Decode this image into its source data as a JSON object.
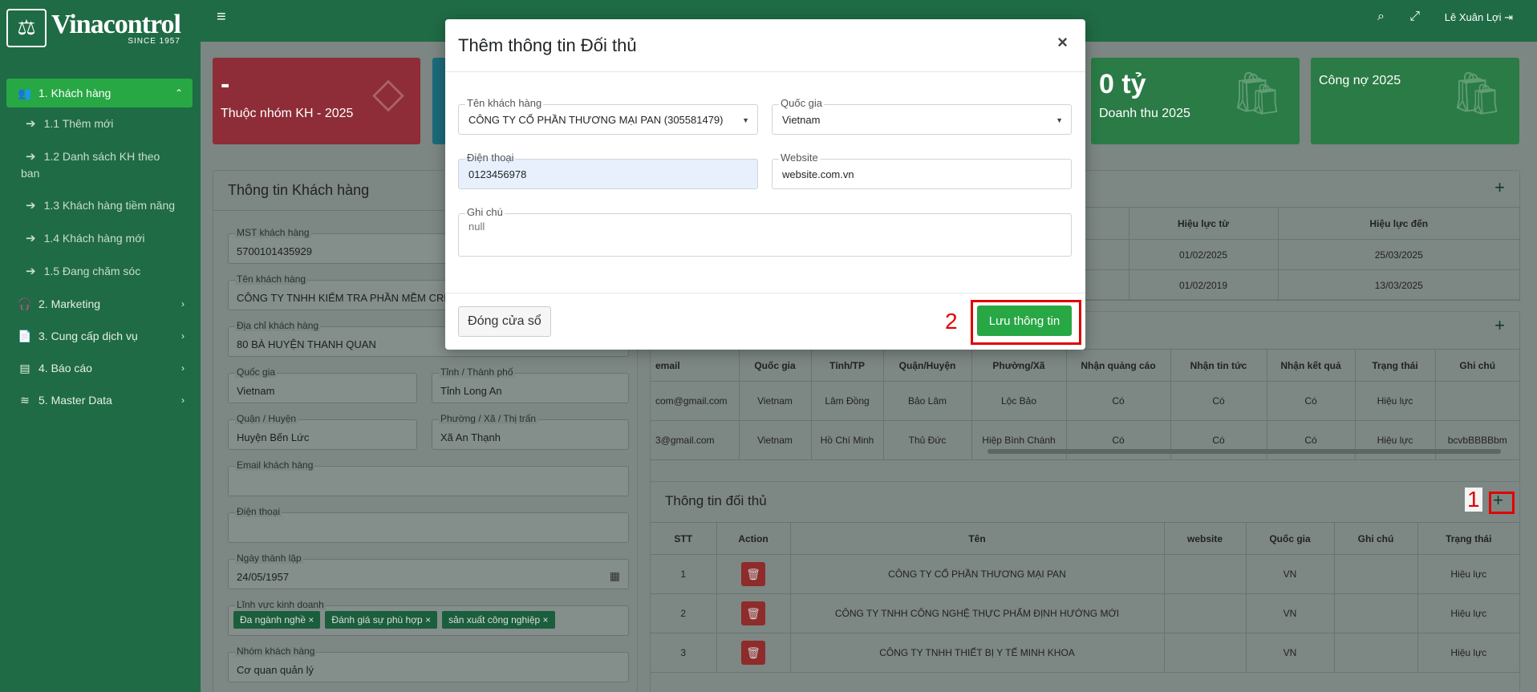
{
  "brand": {
    "name": "Vinacontrol",
    "since": "SINCE 1957",
    "mark": "⚖"
  },
  "sidebar": {
    "items": [
      {
        "label": "1. Khách hàng",
        "icon": "users-icon",
        "glyph": "👥",
        "expanded": true
      },
      {
        "label": "2. Marketing",
        "icon": "headset-icon",
        "glyph": "🎧"
      },
      {
        "label": "3. Cung cấp dịch vụ",
        "icon": "file-icon",
        "glyph": "📄"
      },
      {
        "label": "4. Báo cáo",
        "icon": "report-icon",
        "glyph": "▤"
      },
      {
        "label": "5. Master Data",
        "icon": "database-icon",
        "glyph": "≋"
      }
    ],
    "sub_items": [
      "1.1 Thêm mới",
      "1.2 Danh sách KH theo ban",
      "1.3 Khách hàng tiềm năng",
      "1.4 Khách hàng mới",
      "1.5 Đang chăm sóc"
    ]
  },
  "topbar": {
    "user": "Lê Xuân Lợi"
  },
  "tiles": [
    {
      "big": "-",
      "sub": "Thuộc nhóm KH - 2025",
      "color": "#8e2d37"
    },
    {
      "big": "0 tỷ",
      "sub": "Doanh thu 2025",
      "color": "#2a7b45"
    },
    {
      "big": "",
      "sub": "Công nợ 2025",
      "color": "#2a7b45"
    }
  ],
  "customer_panel": {
    "title": "Thông tin Khách hàng",
    "fields": {
      "mst": {
        "label": "MST khách hàng",
        "value": "5700101435929"
      },
      "name": {
        "label": "Tên khách hàng",
        "value": "CÔNG TY TNHH KIỂM TRA PHẦN MỀM CRM"
      },
      "address": {
        "label": "Địa chỉ khách hàng",
        "value": "80 BÀ HUYỆN THANH QUAN"
      },
      "country": {
        "label": "Quốc gia",
        "value": "Vietnam"
      },
      "province": {
        "label": "Tỉnh / Thành phố",
        "value": "Tỉnh Long An"
      },
      "district": {
        "label": "Quận / Huyện",
        "value": "Huyện Bến Lức"
      },
      "ward": {
        "label": "Phường / Xã / Thị trấn",
        "value": "Xã An Thạnh"
      },
      "email": {
        "label": "Email khách hàng"
      },
      "phone": {
        "label": "Điện thoại"
      },
      "founded": {
        "label": "Ngày thành lập",
        "value": "24/05/1957"
      },
      "business": {
        "label": "Lĩnh vực kinh doanh",
        "tags": [
          "Đa ngành nghề",
          "Đánh giá sự phù hợp",
          "sản xuất công nghiệp"
        ]
      },
      "group": {
        "label": "Nhóm khách hàng",
        "value": "Cơ quan quản lý"
      }
    }
  },
  "validity_table": {
    "headers": [
      "Hiệu lực từ",
      "Hiệu lực đến"
    ],
    "rows": [
      [
        "01/02/2025",
        "25/03/2025"
      ],
      [
        "01/02/2019",
        "13/03/2025"
      ]
    ]
  },
  "contact_table": {
    "headers": [
      "email",
      "Quốc gia",
      "Tỉnh/TP",
      "Quận/Huyện",
      "Phường/Xã",
      "Nhận quảng cáo",
      "Nhận tin tức",
      "Nhận kết quả",
      "Trạng thái",
      "Ghi chú"
    ],
    "rows": [
      [
        "com@gmail.com",
        "Vietnam",
        "Lâm Đồng",
        "Bảo Lâm",
        "Lộc Bảo",
        "Có",
        "Có",
        "Có",
        "Hiệu lực",
        ""
      ],
      [
        "3@gmail.com",
        "Vietnam",
        "Hồ Chí Minh",
        "Thủ Đức",
        "Hiệp Bình Chánh",
        "Có",
        "Có",
        "Có",
        "Hiệu lực",
        "bcvbBBBBbm"
      ]
    ]
  },
  "competitor_panel": {
    "title": "Thông tin đối thủ",
    "headers": [
      "STT",
      "Action",
      "Tên",
      "website",
      "Quốc gia",
      "Ghi chú",
      "Trạng thái"
    ],
    "rows": [
      [
        "1",
        "",
        "CÔNG TY CỔ PHẦN THƯƠNG MẠI PAN",
        "",
        "VN",
        "",
        "Hiệu lực"
      ],
      [
        "2",
        "",
        "CÔNG TY TNHH CÔNG NGHỆ THỰC PHẨM ĐỊNH HƯỚNG MỚI",
        "",
        "VN",
        "",
        "Hiệu lực"
      ],
      [
        "3",
        "",
        "CÔNG TY TNHH THIẾT BỊ Y TẾ MINH KHOA",
        "",
        "VN",
        "",
        "Hiệu lực"
      ]
    ]
  },
  "modal": {
    "title": "Thêm thông tin Đối thủ",
    "customer_label": "Tên khách hàng",
    "customer_value": "CÔNG TY CỔ PHẦN THƯƠNG MẠI PAN (305581479)",
    "country_label": "Quốc gia",
    "country_value": "Vietnam",
    "phone_label": "Điện thoại",
    "phone_value": "0123456978",
    "website_label": "Website",
    "website_value": "website.com.vn",
    "note_label": "Ghi chú",
    "note_placeholder": "null",
    "close_button": "Đóng cửa sổ",
    "save_button": "Lưu thông tin"
  },
  "annotations": {
    "step1": "1",
    "step2": "2"
  },
  "colors": {
    "primary": "#1f6b45",
    "accent": "#28a745",
    "danger": "#e00000"
  }
}
